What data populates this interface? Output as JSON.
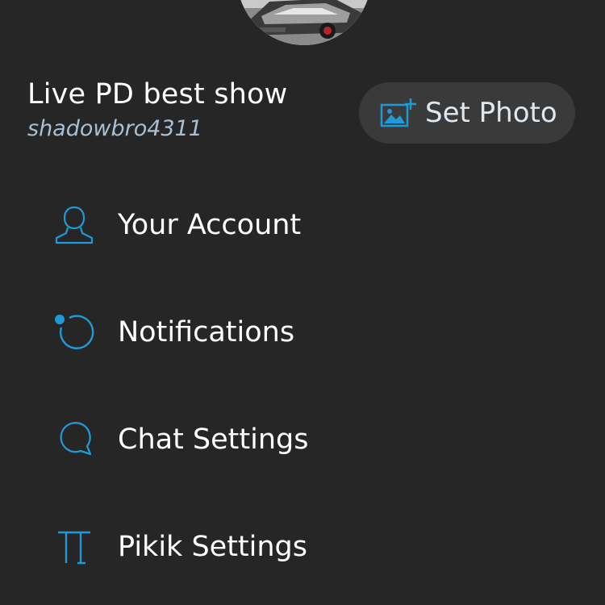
{
  "profile": {
    "display_name": "Live PD best show",
    "username": "shadowbro4311",
    "set_photo_label": "Set Photo"
  },
  "colors": {
    "background": "#262626",
    "accent": "#1e9ad6",
    "username_text": "#a9c0d2",
    "button_bg": "#3a3a3a"
  },
  "menu": {
    "items": [
      {
        "label": "Your Account",
        "icon": "person-icon"
      },
      {
        "label": "Notifications",
        "icon": "notification-circle-icon"
      },
      {
        "label": "Chat Settings",
        "icon": "chat-bubble-icon"
      },
      {
        "label": "Pikik Settings",
        "icon": "pi-icon"
      }
    ]
  }
}
